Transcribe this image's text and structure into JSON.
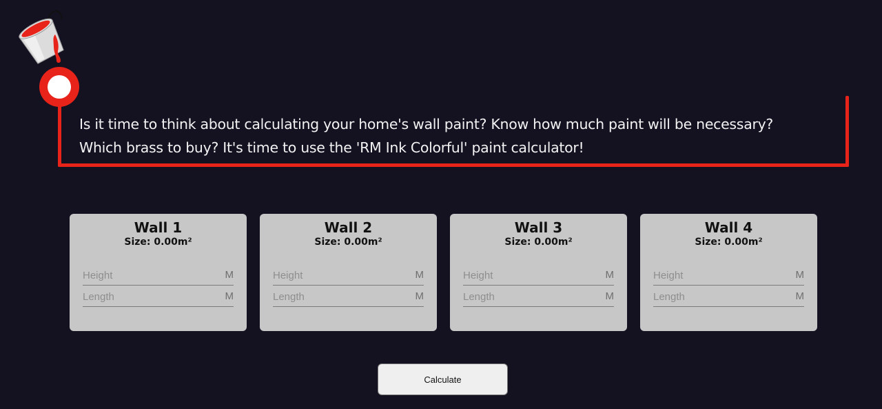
{
  "intro": {
    "text_line1": "Is it time to think about calculating your home's wall paint? Know how much paint will be necessary?",
    "text_line2": "Which brass to buy? It's time to use the 'RM Ink Colorful' paint calculator!"
  },
  "icons": {
    "logo": "paint-bucket-icon"
  },
  "colors": {
    "background": "#141221",
    "accent": "#e8241a",
    "card": "#c8c7c8"
  },
  "walls": [
    {
      "title": "Wall 1",
      "size": "Size: 0.00m²",
      "height_placeholder": "Height",
      "height_unit": "M",
      "length_placeholder": "Length",
      "length_unit": "M"
    },
    {
      "title": "Wall 2",
      "size": "Size: 0.00m²",
      "height_placeholder": "Height",
      "height_unit": "M",
      "length_placeholder": "Length",
      "length_unit": "M"
    },
    {
      "title": "Wall 3",
      "size": "Size: 0.00m²",
      "height_placeholder": "Height",
      "height_unit": "M",
      "length_placeholder": "Length",
      "length_unit": "M"
    },
    {
      "title": "Wall 4",
      "size": "Size: 0.00m²",
      "height_placeholder": "Height",
      "height_unit": "M",
      "length_placeholder": "Length",
      "length_unit": "M"
    }
  ],
  "actions": {
    "calculate_label": "Calculate"
  }
}
